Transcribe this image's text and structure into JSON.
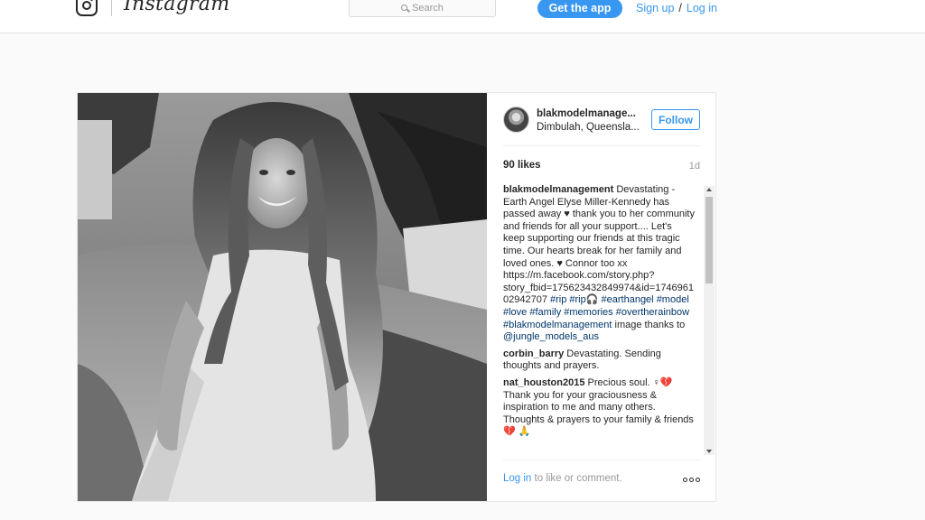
{
  "nav": {
    "brand": "Instagram",
    "search_placeholder": "Search",
    "get_app": "Get the app",
    "sign_up": "Sign up",
    "separator": "/",
    "log_in": "Log in"
  },
  "post": {
    "username": "blakmodelmanage...",
    "location": "Dimbulah, Queensla...",
    "follow": "Follow",
    "likes": "90 likes",
    "age": "1d",
    "caption": {
      "author": "blakmodelmanagement",
      "text": " Devastating - Earth Angel Elyse Miller-Kennedy has passed away ♥ thank you to her community and friends for all your support.... Let's keep supporting our friends at this tragic time. Our hearts break for her family and loved ones. ♥ Connor too xx https://m.facebook.com/story.php?story_fbid=175623432849974&id=174696102942707 ",
      "tags": [
        "#rip",
        "#rip🎧",
        "#earthangel",
        "#model",
        "#love",
        "#family",
        "#memories",
        "#overtherainbow",
        "#blakmodelmanagement"
      ],
      "tail": " image thanks to ",
      "mention": "@jungle_models_aus"
    },
    "comments": [
      {
        "author": "corbin_barry",
        "text": " Devastating. Sending thoughts and prayers."
      },
      {
        "author": "nat_houston2015",
        "text": " Precious soul. ♀💔 Thank you for your graciousness & inspiration to me and many others. Thoughts & prayers to your family & friends 💔 🙏"
      }
    ],
    "footer_login": "Log in",
    "footer_rest": " to like or comment."
  },
  "colors": {
    "accent": "#3897f0",
    "tag": "#003569"
  }
}
